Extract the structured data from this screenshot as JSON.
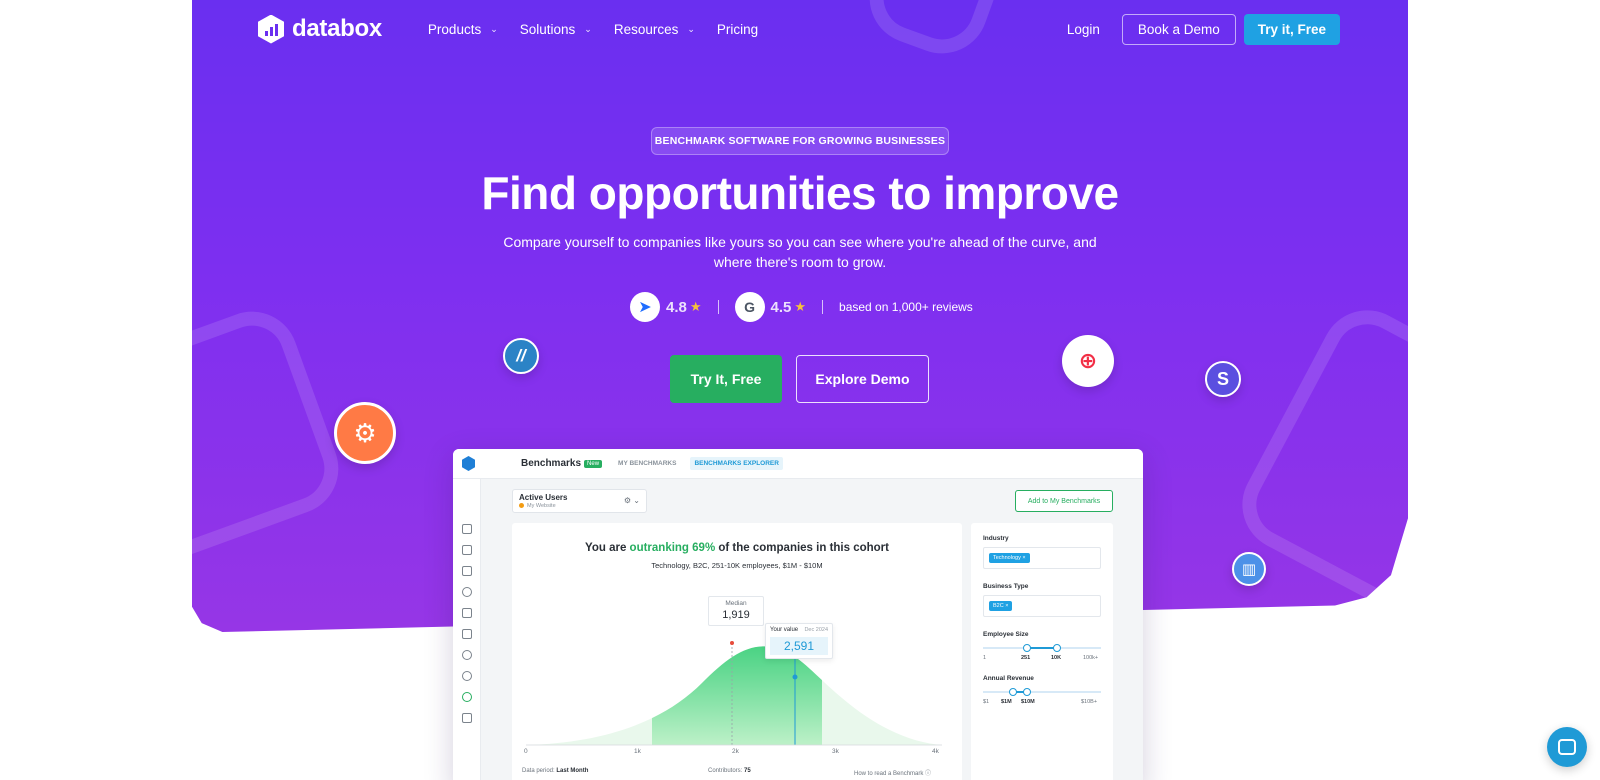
{
  "brand": {
    "name": "databox"
  },
  "nav": {
    "menu": [
      {
        "label": "Products",
        "has_dropdown": true
      },
      {
        "label": "Solutions",
        "has_dropdown": true
      },
      {
        "label": "Resources",
        "has_dropdown": true
      },
      {
        "label": "Pricing",
        "has_dropdown": false
      }
    ],
    "login": "Login",
    "book_demo": "Book a Demo",
    "try_free": "Try it, Free"
  },
  "hero": {
    "badge": "BENCHMARK SOFTWARE FOR GROWING BUSINESSES",
    "headline": "Find opportunities to improve",
    "subhead": "Compare yourself to companies like yours so you can see where you're ahead of the curve, and where there's room to grow.",
    "ratings": [
      {
        "icon": "capterra-icon",
        "score": "4.8"
      },
      {
        "icon": "g2-icon",
        "score": "4.5"
      }
    ],
    "reviews_text": "based on 1,000+ reviews",
    "cta_primary": "Try It, Free",
    "cta_secondary": "Explore Demo"
  },
  "integrations": [
    "hubspot-icon",
    "harvest-icon",
    "twilio-icon",
    "stripe-icon",
    "intercom-icon"
  ],
  "dashboard": {
    "title": "Benchmarks",
    "new_badge": "New",
    "tabs": [
      "MY BENCHMARKS",
      "BENCHMARKS EXPLORER"
    ],
    "active_tab": "BENCHMARKS EXPLORER",
    "metric": {
      "name": "Active Users",
      "source": "My Website"
    },
    "add_button": "Add to My Benchmarks",
    "headline_pre": "You are ",
    "headline_hl": "outranking 69%",
    "headline_post": " of the companies in this cohort",
    "cohort": "Technology, B2C, 251-10K employees, $1M - $10M",
    "median_label": "Median",
    "median_value": "1,919",
    "your_label": "Your value",
    "your_date": "Dec 2024",
    "your_value": "2,591",
    "ticks": [
      "0",
      "1k",
      "2k",
      "3k",
      "4k"
    ],
    "data_period_label": "Data period:",
    "data_period": "Last Month",
    "contributors_label": "Contributors:",
    "contributors": "75",
    "how_to": "How to read a Benchmark",
    "filters": {
      "industry_label": "Industry",
      "industry_value": "Technology",
      "business_label": "Business Type",
      "business_value": "B2C",
      "employee_label": "Employee Size",
      "employee_ticks": [
        "1",
        "251",
        "10K",
        "100k+"
      ],
      "revenue_label": "Annual Revenue",
      "revenue_ticks": [
        "$1",
        "$1M",
        "$10M",
        "$10B+"
      ]
    }
  },
  "colors": {
    "primary_purple": "#6a2ff0",
    "accent_blue": "#1fa1e3",
    "cta_green": "#27ae60"
  }
}
